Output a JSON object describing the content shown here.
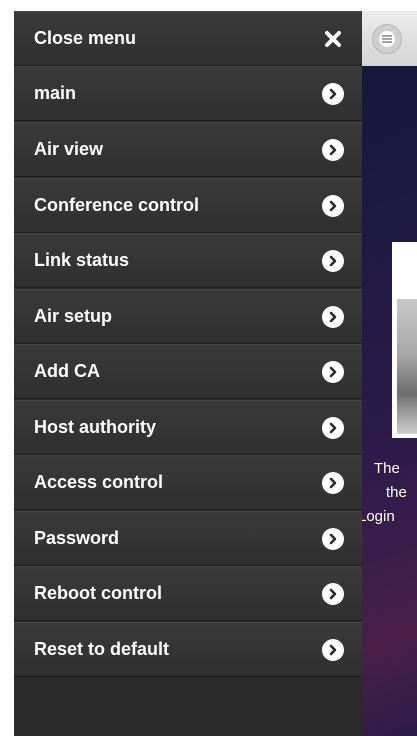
{
  "menu": {
    "close_label": "Close menu",
    "items": [
      {
        "label": "main"
      },
      {
        "label": "Air view"
      },
      {
        "label": "Conference control"
      },
      {
        "label": "Link status"
      },
      {
        "label": "Air setup"
      },
      {
        "label": "Add CA"
      },
      {
        "label": "Host authority"
      },
      {
        "label": "Access control"
      },
      {
        "label": "Password"
      },
      {
        "label": "Reboot control"
      },
      {
        "label": "Reset to default"
      }
    ]
  },
  "background": {
    "text_line1": "The",
    "text_line2": "the",
    "text_line3": "Login"
  },
  "colors": {
    "menu_bg": "#2f2f2f",
    "menu_text": "#ffffff",
    "chevron_circle": "#ffffff"
  },
  "icons": {
    "close": "close-icon",
    "chevron": "chevron-right-icon",
    "menu": "menu-icon"
  }
}
